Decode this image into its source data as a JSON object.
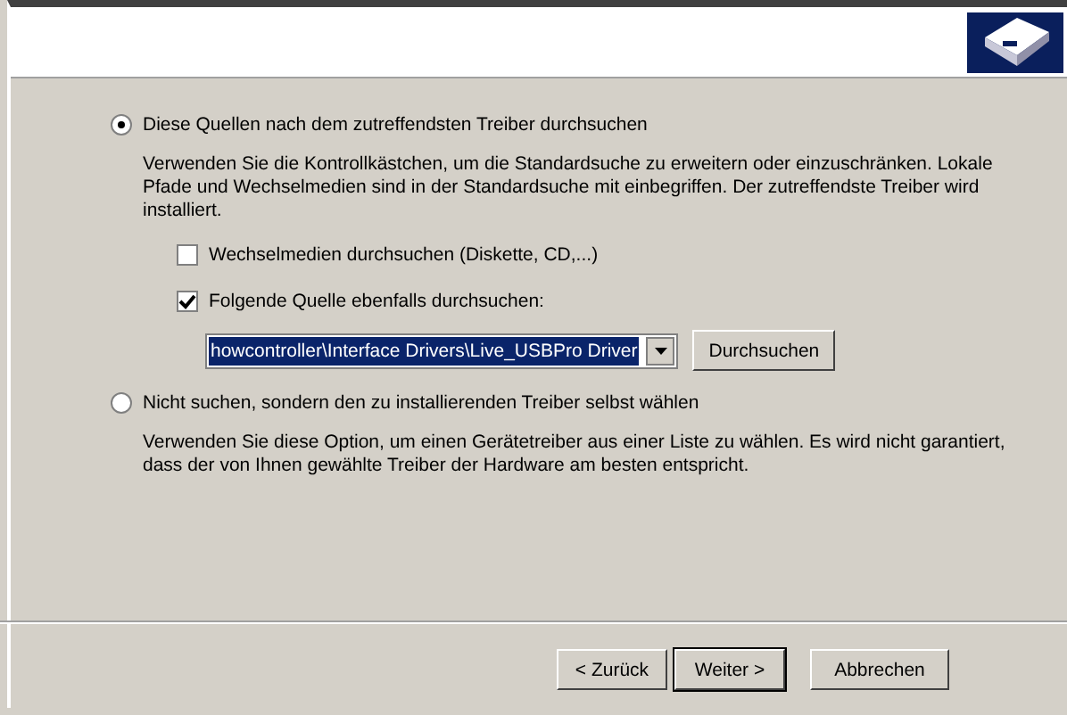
{
  "options": [
    {
      "label": "Diese Quellen nach dem zutreffendsten Treiber durchsuchen",
      "selected": true,
      "description": "Verwenden Sie die Kontrollkästchen, um die Standardsuche zu erweitern oder einzuschränken. Lokale Pfade und Wechselmedien sind in der Standardsuche mit einbegriffen. Der zutreffendste Treiber wird installiert.",
      "checkboxes": [
        {
          "label": "Wechselmedien durchsuchen (Diskette, CD,...)",
          "checked": false
        },
        {
          "label": "Folgende Quelle ebenfalls durchsuchen:",
          "checked": true
        }
      ],
      "path": {
        "value": "howcontroller\\Interface Drivers\\Live_USBPro Driver",
        "browse": "Durchsuchen"
      }
    },
    {
      "label": "Nicht suchen, sondern den zu installierenden Treiber selbst wählen",
      "selected": false,
      "description": "Verwenden Sie diese Option, um einen Gerätetreiber aus einer Liste zu wählen. Es wird nicht garantiert, dass der von Ihnen gewählte Treiber der Hardware am besten entspricht."
    }
  ],
  "buttons": [
    {
      "label": "< Zurück",
      "default": false
    },
    {
      "label": "Weiter >",
      "default": true
    },
    {
      "label": "Abbrechen",
      "default": false
    }
  ]
}
